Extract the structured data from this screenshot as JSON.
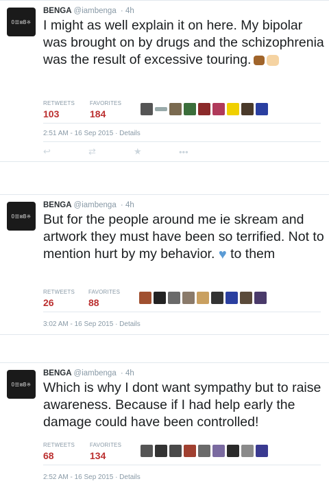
{
  "tweets": [
    {
      "avatar_text": "O☰⊠B※",
      "name": "BENGA",
      "handle": "@iambenga",
      "time_ago": "· 4h",
      "text": "I might as well explain it on here. My bipolar was brought on by drugs and the schizophrenia was the result of excessive touring.",
      "retweets_label": "RETWEETS",
      "retweets": "103",
      "favorites_label": "FAVORITES",
      "favorites": "184",
      "timestamp": "2:51 AM - 16 Sep 2015 · Details",
      "actions": [
        "reply",
        "retweet",
        "favorite",
        "more"
      ]
    },
    {
      "avatar_text": "O☰⊠B※",
      "name": "BENGA",
      "handle": "@iambenga",
      "time_ago": "· 4h",
      "text_before": "But for the people around me ie skream and artwork they must have been so terrified. Not to mention hurt by my behavior.",
      "text_after": "to them",
      "retweets_label": "RETWEETS",
      "retweets": "26",
      "favorites_label": "FAVORITES",
      "favorites": "88",
      "timestamp": "3:02 AM - 16 Sep 2015 · Details"
    },
    {
      "avatar_text": "O☰⊠B※",
      "name": "BENGA",
      "handle": "@iambenga",
      "time_ago": "· 4h",
      "text": "Which is why I dont want sympathy but to raise awareness. Because if I had help early the damage could have been controlled!",
      "retweets_label": "RETWEETS",
      "retweets": "68",
      "favorites_label": "FAVORITES",
      "favorites": "134",
      "timestamp": "2:52 AM - 16 Sep 2015 · Details"
    }
  ],
  "colors": {
    "count": "#bb2f2f",
    "muted": "#8899a6",
    "border": "#e1e8ed",
    "heart": "#5b9bd5"
  },
  "icons": {
    "reply": "reply-icon",
    "retweet": "retweet-icon",
    "favorite": "star-icon",
    "more": "more-icon"
  }
}
